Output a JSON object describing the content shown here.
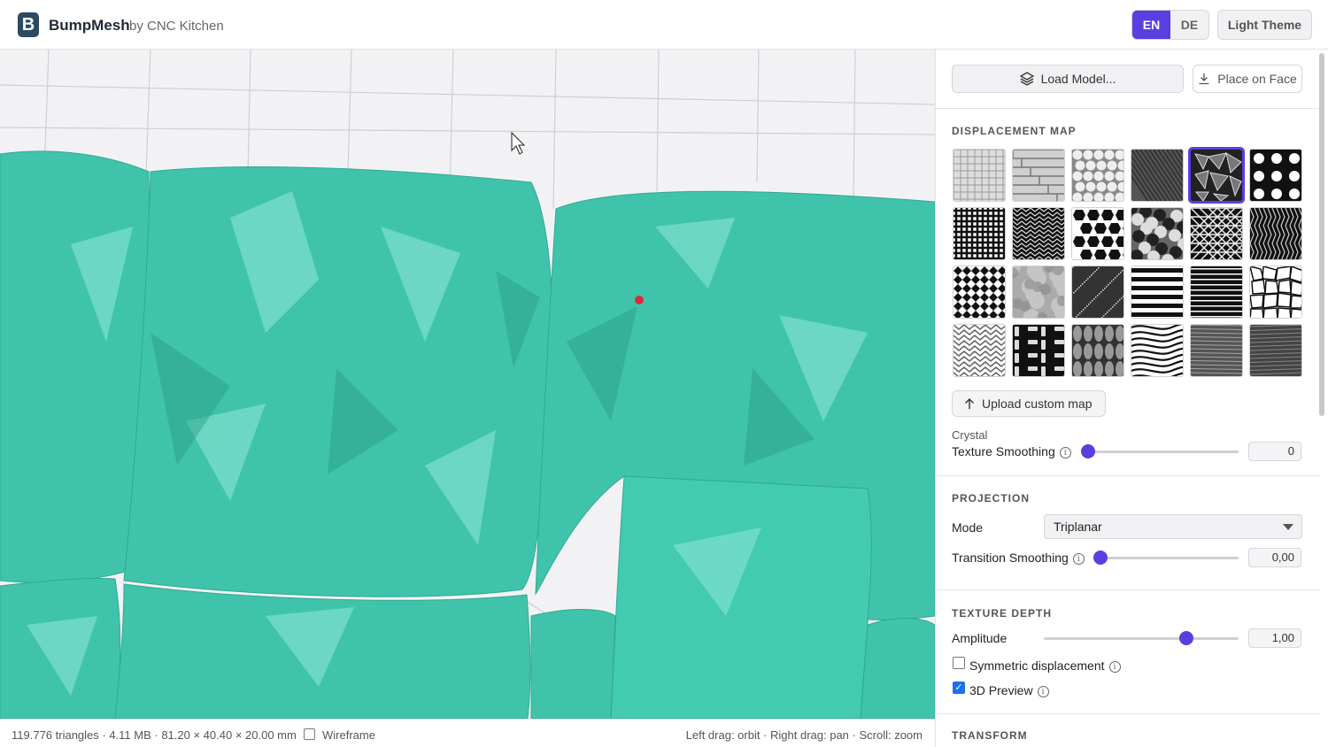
{
  "header": {
    "logo_letter": "B",
    "app_name": "BumpMesh",
    "by": "by CNC Kitchen",
    "languages": [
      "EN",
      "DE"
    ],
    "active_language": "EN",
    "theme_button": "Light Theme",
    "accent": "#5a3fe0"
  },
  "viewport": {
    "mesh_color": "#3fc4ab",
    "marker_color": "#e0283a"
  },
  "statusbar": {
    "stats": "119.776 triangles · 4.11 MB · 81.20 × 40.40 × 20.00 mm",
    "wireframe_label": "Wireframe",
    "wireframe_checked": false,
    "hints": "Left drag: orbit  ·  Right drag: pan  ·  Scroll: zoom"
  },
  "panel": {
    "load_model": "Load Model...",
    "place_on_face": "Place on Face",
    "displacement_map": {
      "title": "DISPLACEMENT MAP",
      "tiles": [
        "tile-1",
        "tile-2",
        "tile-3",
        "tile-4",
        "tile-5",
        "tile-6",
        "tile-7",
        "tile-8",
        "tile-9",
        "tile-10",
        "tile-11",
        "tile-12",
        "tile-13",
        "tile-14",
        "tile-15",
        "tile-16",
        "tile-17",
        "tile-18",
        "tile-19",
        "tile-20",
        "tile-21",
        "tile-22",
        "tile-23",
        "tile-24"
      ],
      "selected_index": 4,
      "upload_label": "Upload custom map",
      "selected_name": "Crystal",
      "texture_smoothing_label": "Texture Smoothing",
      "texture_smoothing_value": "0",
      "texture_smoothing_fraction": 0.0
    },
    "projection": {
      "title": "PROJECTION",
      "mode_label": "Mode",
      "mode_value": "Triplanar",
      "transition_label": "Transition Smoothing",
      "transition_value": "0,00",
      "transition_fraction": 0.0
    },
    "texture_depth": {
      "title": "TEXTURE DEPTH",
      "amplitude_label": "Amplitude",
      "amplitude_value": "1,00",
      "amplitude_fraction": 0.73,
      "symmetric_label": "Symmetric displacement",
      "symmetric_checked": false,
      "preview_label": "3D Preview",
      "preview_checked": true
    },
    "transform": {
      "title": "TRANSFORM"
    }
  }
}
